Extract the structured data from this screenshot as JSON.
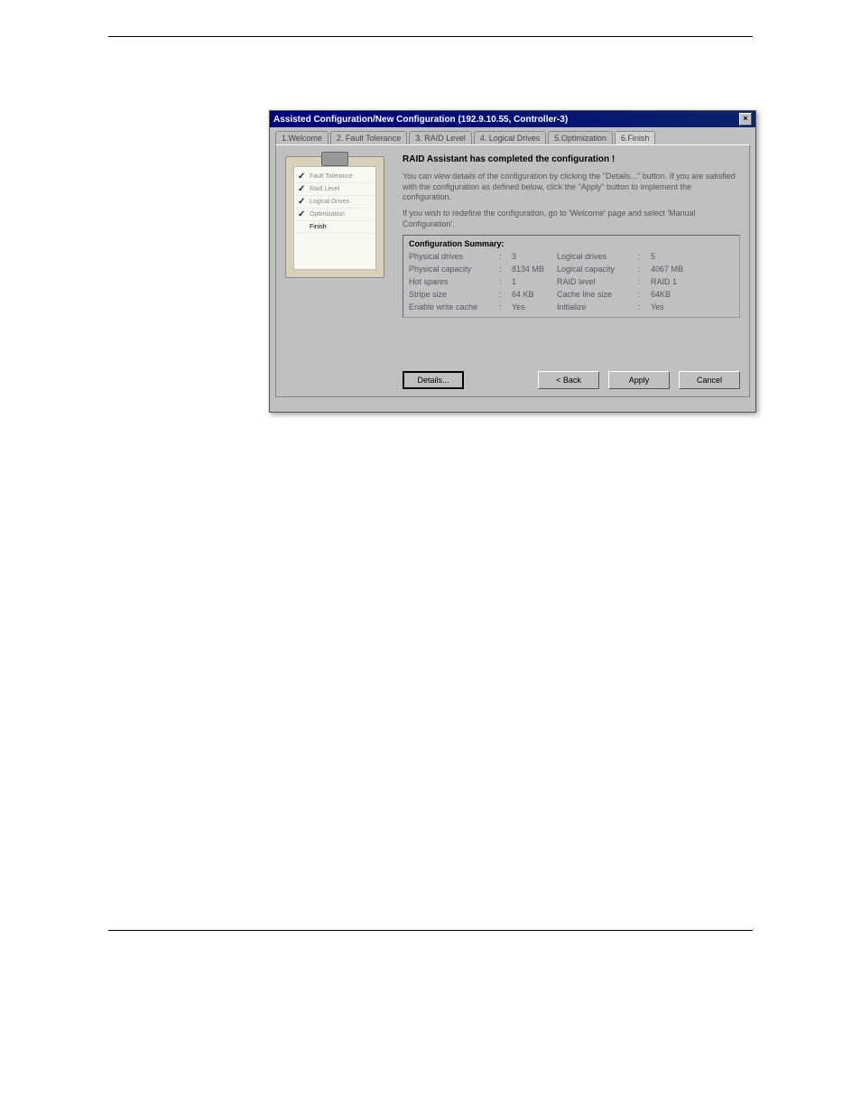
{
  "window": {
    "title": "Assisted Configuration/New Configuration (192.9.10.55, Controller-3)"
  },
  "tabs": [
    {
      "label": "1.Welcome"
    },
    {
      "label": "2. Fault Tolerance"
    },
    {
      "label": "3. RAID Level"
    },
    {
      "label": "4. Logical Drives"
    },
    {
      "label": "5.Optimization"
    },
    {
      "label": "6.Finish",
      "active": true
    }
  ],
  "steps": [
    {
      "label": "Fault Tolerance",
      "done": true
    },
    {
      "label": "Raid Level",
      "done": true
    },
    {
      "label": "Logical Drives",
      "done": true
    },
    {
      "label": "Optimization",
      "done": true
    },
    {
      "label": "Finish",
      "done": false,
      "current": true
    }
  ],
  "content": {
    "heading": "RAID Assistant has completed the configuration !",
    "para1": "You can view details of the configuration by clicking the \"Details...\" button. If you are satisfied with the configuration as defined below, click the \"Apply\" button to implement the configuration.",
    "para2": "If you wish to redefine the configuration, go to 'Welcome' page and select 'Manual Configuration'."
  },
  "summary": {
    "title": "Configuration Summary:",
    "rows": [
      {
        "l1": "Physical drives",
        "v1": "3",
        "l2": "Logical drives",
        "v2": "5"
      },
      {
        "l1": "Physical capacity",
        "v1": "8134 MB",
        "l2": "Logical capacity",
        "v2": "4067 MB"
      },
      {
        "l1": "Hot spares",
        "v1": "1",
        "l2": "RAID level",
        "v2": "RAID 1"
      },
      {
        "l1": "Stripe size",
        "v1": "64 KB",
        "l2": "Cache line size",
        "v2": "64KB"
      },
      {
        "l1": "Enable write cache",
        "v1": "Yes",
        "l2": "Initialize",
        "v2": "Yes"
      }
    ]
  },
  "buttons": {
    "details": "Details...",
    "back": "< Back",
    "apply": "Apply",
    "cancel": "Cancel"
  }
}
